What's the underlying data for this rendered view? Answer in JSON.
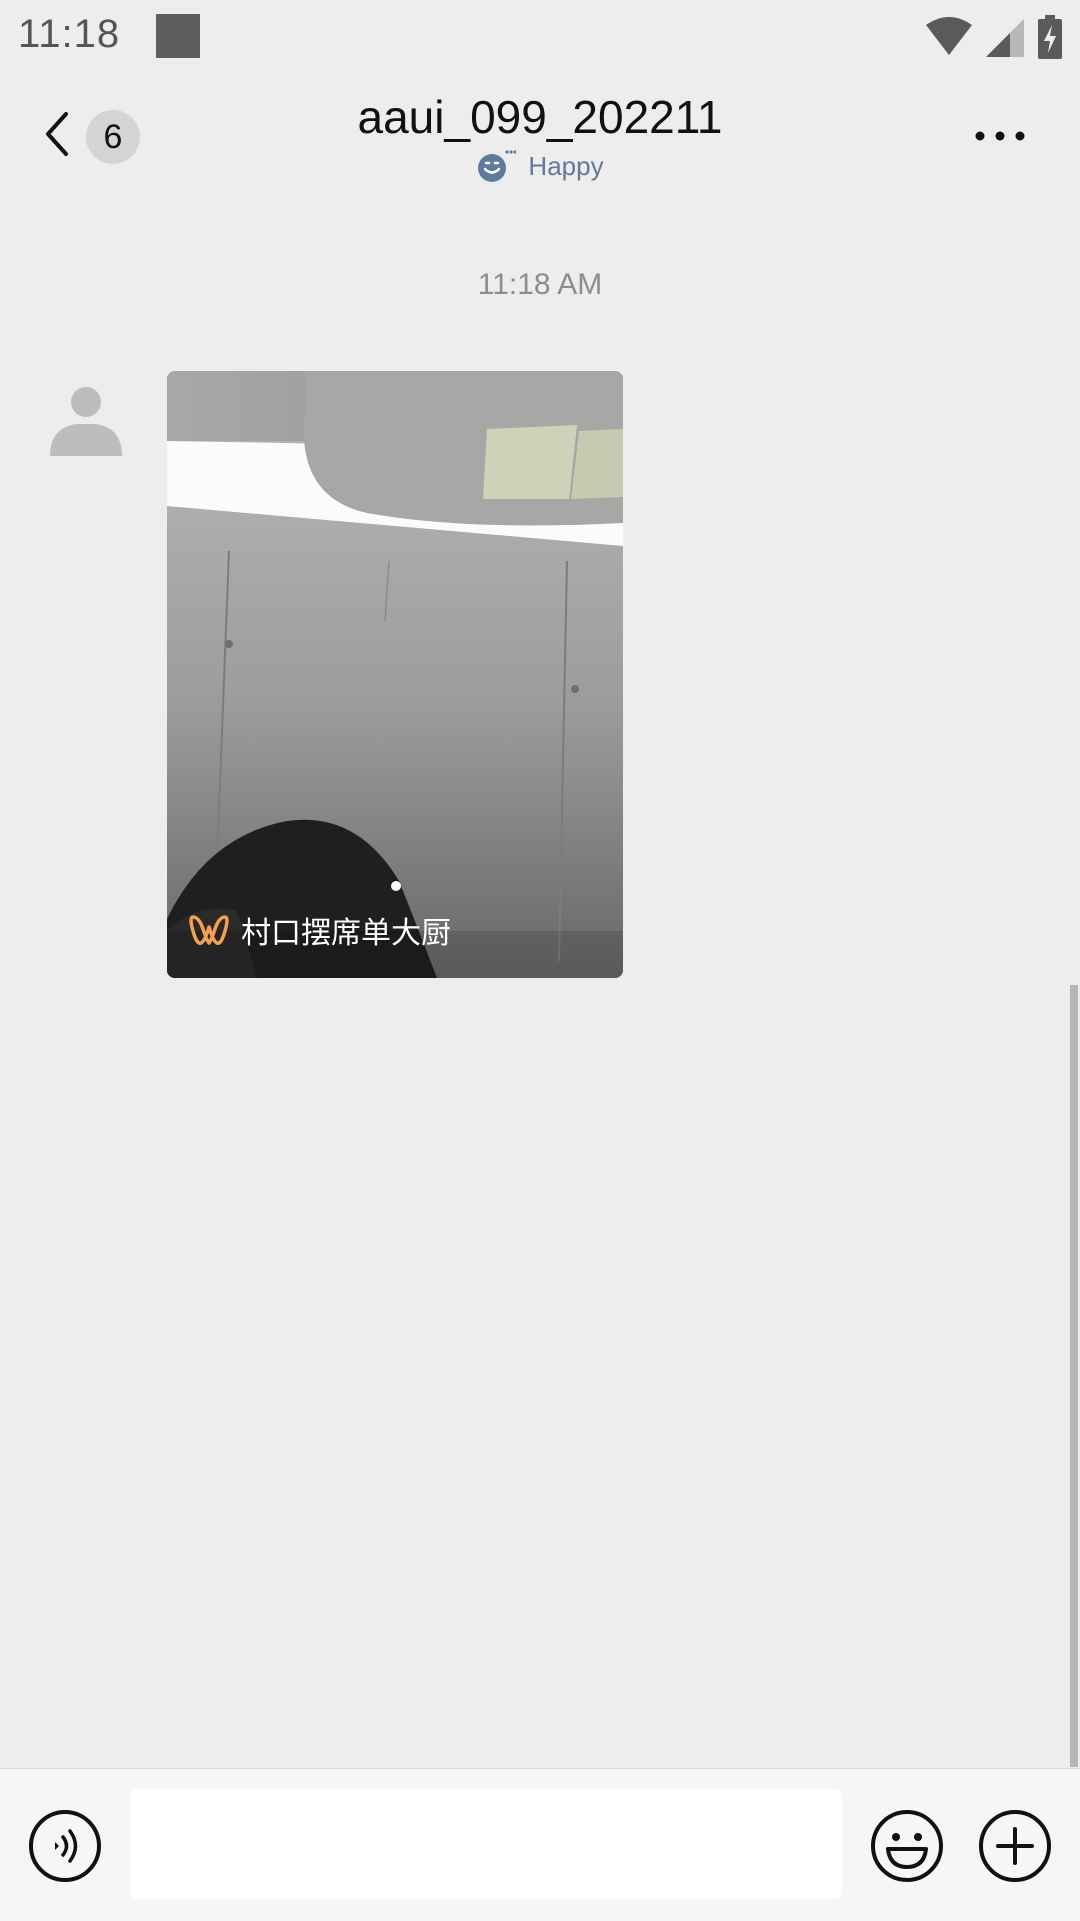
{
  "status_bar": {
    "time": "11:18"
  },
  "header": {
    "unread_count": "6",
    "title": "aaui_099_202211",
    "status_text": "Happy"
  },
  "messages": {
    "timestamp": "11:18 AM",
    "video_card": {
      "caption": "村口摆席单大厨"
    }
  },
  "input": {
    "placeholder": ""
  },
  "icons": {
    "status": [
      "notification-square-icon",
      "wifi-icon",
      "cellular-signal-icon",
      "battery-charging-icon"
    ],
    "header": [
      "back-arrow-icon",
      "mood-emoji-icon",
      "more-options-icon"
    ],
    "message": [
      "default-avatar-icon",
      "video-channel-logo-icon"
    ],
    "input_bar": [
      "voice-icon",
      "emoji-icon",
      "plus-icon"
    ]
  },
  "colors": {
    "background": "#ededed",
    "status_accent": "#5f7a9c",
    "channel_logo": "#f5a04b"
  }
}
